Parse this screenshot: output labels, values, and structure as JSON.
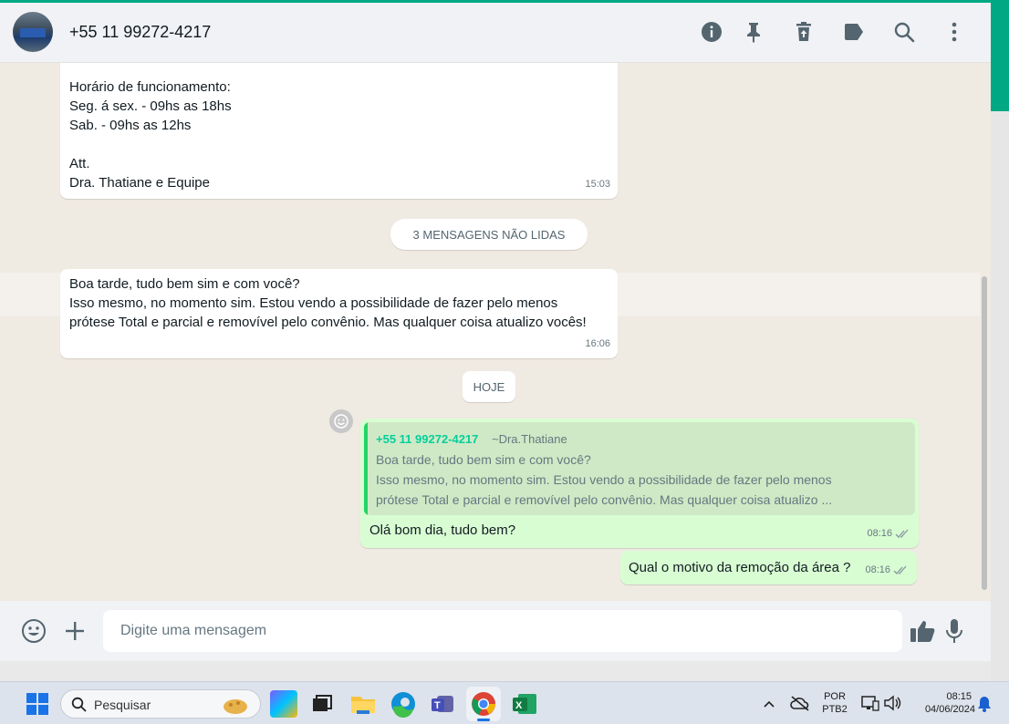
{
  "colors": {
    "accent": "#00a884",
    "incoming": "#ffffff",
    "outgoing": "#d9fdd3",
    "quote_author": "#06cf9c"
  },
  "header": {
    "contact_name": "+55 11 99272-4217"
  },
  "messages": {
    "m1": {
      "lines": [
        "Horário de funcionamento:",
        "Seg. á sex. - 09hs as 18hs",
        "Sab. - 09hs as 12hs",
        "",
        "Att.",
        "Dra. Thatiane e Equipe"
      ],
      "time": "15:03"
    },
    "unread_label": "3 MENSAGENS NÃO LIDAS",
    "m2": {
      "lines": [
        "Boa tarde, tudo bem sim e com você?",
        "Isso mesmo, no momento sim. Estou vendo a possibilidade de fazer pelo menos",
        "prótese Total e parcial e removível pelo convênio. Mas qualquer coisa atualizo vocês!"
      ],
      "time": "16:06"
    },
    "date_label": "HOJE",
    "m3": {
      "quote_author": "+55 11 99272-4217",
      "quote_push": "~Dra.Thatiane",
      "quote_lines": [
        "Boa tarde, tudo bem sim e com você?",
        "Isso mesmo, no momento sim. Estou vendo a possibilidade de fazer pelo menos",
        "prótese Total e parcial e removível pelo convênio. Mas qualquer coisa atualizo ..."
      ],
      "text": "Olá bom dia, tudo bem?",
      "time": "08:16"
    },
    "m4": {
      "text": "Qual o motivo da remoção da área ?",
      "time": "08:16"
    }
  },
  "composer": {
    "placeholder": "Digite uma mensagem"
  },
  "taskbar": {
    "search_label": "Pesquisar",
    "lang_top": "POR",
    "lang_bottom": "PTB2",
    "clock_time": "08:15",
    "clock_date": "04/06/2024"
  }
}
